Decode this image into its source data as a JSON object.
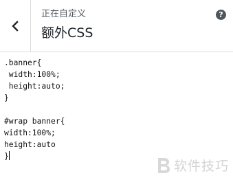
{
  "header": {
    "subtitle": "正在自定义",
    "title_zh": "额外",
    "title_en": "CSS",
    "help_glyph": "?"
  },
  "icons": {
    "back": "chevron-left-icon",
    "help": "question-circle-icon"
  },
  "editor": {
    "lines": [
      ".banner{",
      " width:100%;",
      " height:auto;",
      "}",
      "",
      "#wrap banner{",
      "width:100%;",
      "height:auto",
      "}"
    ]
  },
  "watermark": {
    "text": "软件技巧"
  },
  "colors": {
    "border": "#dcdcde",
    "text": "#1d2327",
    "subtext": "#50575e",
    "watermark": "#d0d0d0"
  }
}
